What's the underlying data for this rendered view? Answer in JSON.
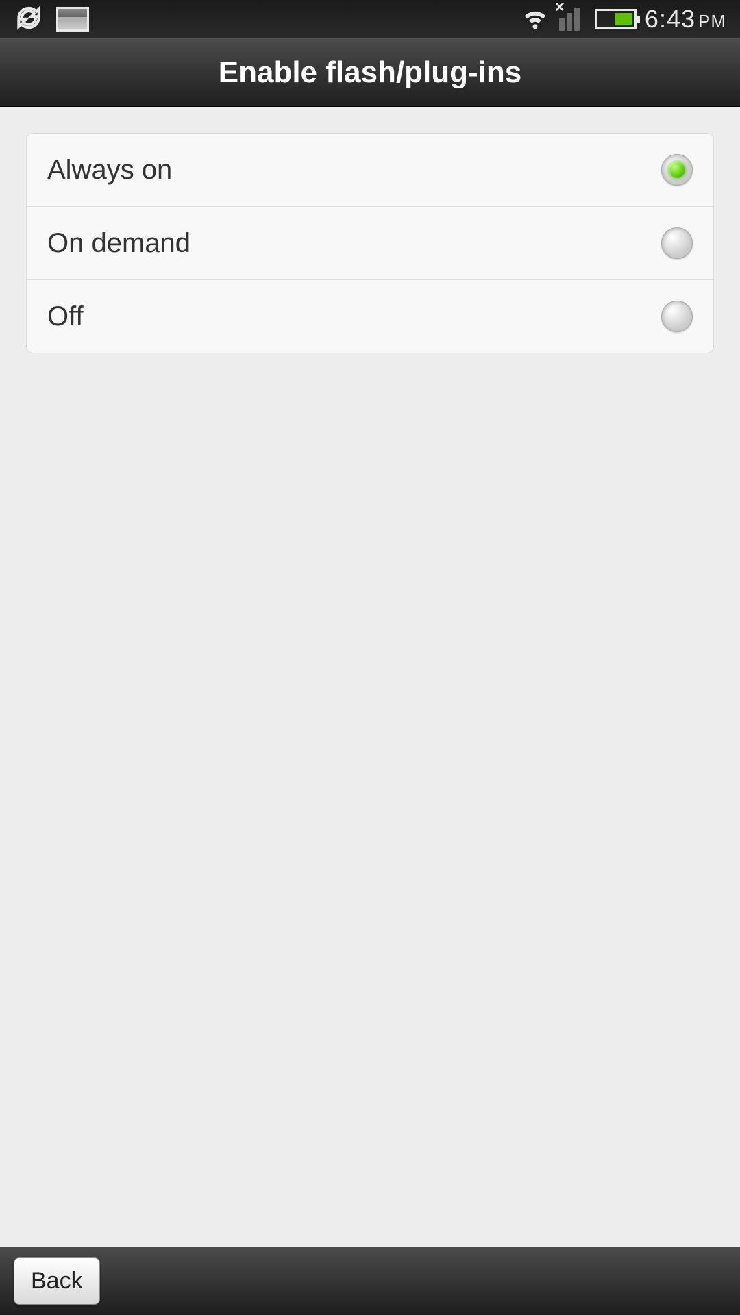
{
  "status": {
    "time": "6:43",
    "ampm": "PM"
  },
  "header": {
    "title": "Enable flash/plug-ins"
  },
  "options": [
    {
      "label": "Always on",
      "selected": true
    },
    {
      "label": "On demand",
      "selected": false
    },
    {
      "label": "Off",
      "selected": false
    }
  ],
  "footer": {
    "back_label": "Back"
  }
}
